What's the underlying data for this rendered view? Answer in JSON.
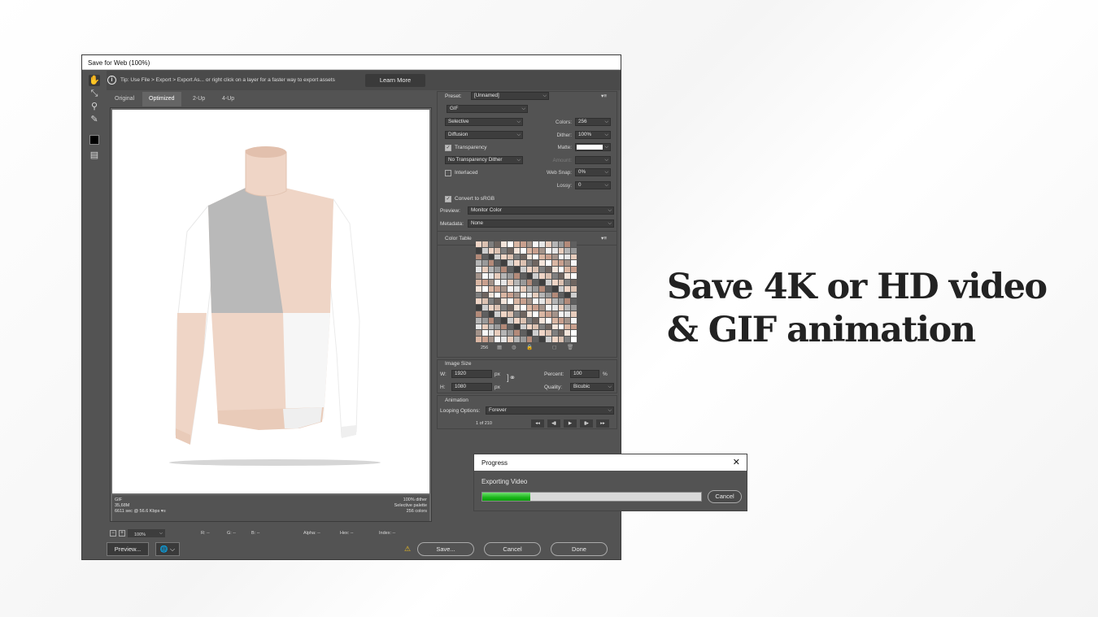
{
  "dialog": {
    "title": "Save for Web (100%)",
    "tip": "Tip: Use File > Export > Export As...  or right click on a layer for a faster way to export assets",
    "learn_more": "Learn More",
    "tabs": [
      {
        "label": "Original"
      },
      {
        "label": "Optimized"
      },
      {
        "label": "2-Up"
      },
      {
        "label": "4-Up"
      }
    ],
    "canvas_info": {
      "format": "GIF",
      "size": "35,68M",
      "time": "6611 sec @ 56.6 Kbps",
      "dither": "100% dither",
      "palette": "Selective palette",
      "colors": "256 colors"
    },
    "status": {
      "zoom": "100%",
      "r": "R: --",
      "g": "G: --",
      "b": "B: --",
      "alpha": "Alpha: --",
      "hex": "Hex: --",
      "index": "Index: --"
    },
    "buttons": {
      "preview": "Preview...",
      "save": "Save...",
      "cancel": "Cancel",
      "done": "Done"
    }
  },
  "settings": {
    "preset_label": "Preset:",
    "preset_value": "[Unnamed]",
    "format": "GIF",
    "reduction": "Selective",
    "dither_algo": "Diffusion",
    "transparency": "Transparency",
    "transparency_dither": "No Transparency Dither",
    "interlaced": "Interlaced",
    "colors_label": "Colors:",
    "colors_value": "256",
    "dither_label": "Dither:",
    "dither_value": "100%",
    "matte_label": "Matte:",
    "amount_label": "Amount:",
    "websnap_label": "Web Snap:",
    "websnap_value": "0%",
    "lossy_label": "Lossy:",
    "lossy_value": "0",
    "convert_srgb": "Convert to sRGB",
    "preview_label": "Preview:",
    "preview_value": "Monitor Color",
    "metadata_label": "Metadata:",
    "metadata_value": "None",
    "color_table_label": "Color Table",
    "color_count": "256"
  },
  "image_size": {
    "label": "Image Size",
    "w_label": "W:",
    "w_value": "1920",
    "h_label": "H:",
    "h_value": "1080",
    "px": "px",
    "percent_label": "Percent:",
    "percent_value": "100",
    "percent_unit": "%",
    "quality_label": "Quality:",
    "quality_value": "Bicubic"
  },
  "animation": {
    "label": "Animation",
    "looping_label": "Looping Options:",
    "looping_value": "Forever",
    "frame": "1 of 210"
  },
  "progress": {
    "title": "Progress",
    "label": "Exporting Video",
    "value": 0.22,
    "cancel": "Cancel"
  },
  "headline": {
    "line1": "Save 4K or HD video",
    "line2": "& GIF animation"
  },
  "colors": {
    "accent_green": "#19b519",
    "panel_bg": "#535353",
    "sweater_peach": "#efd5c6",
    "sweater_gray": "#b9b9b9"
  }
}
